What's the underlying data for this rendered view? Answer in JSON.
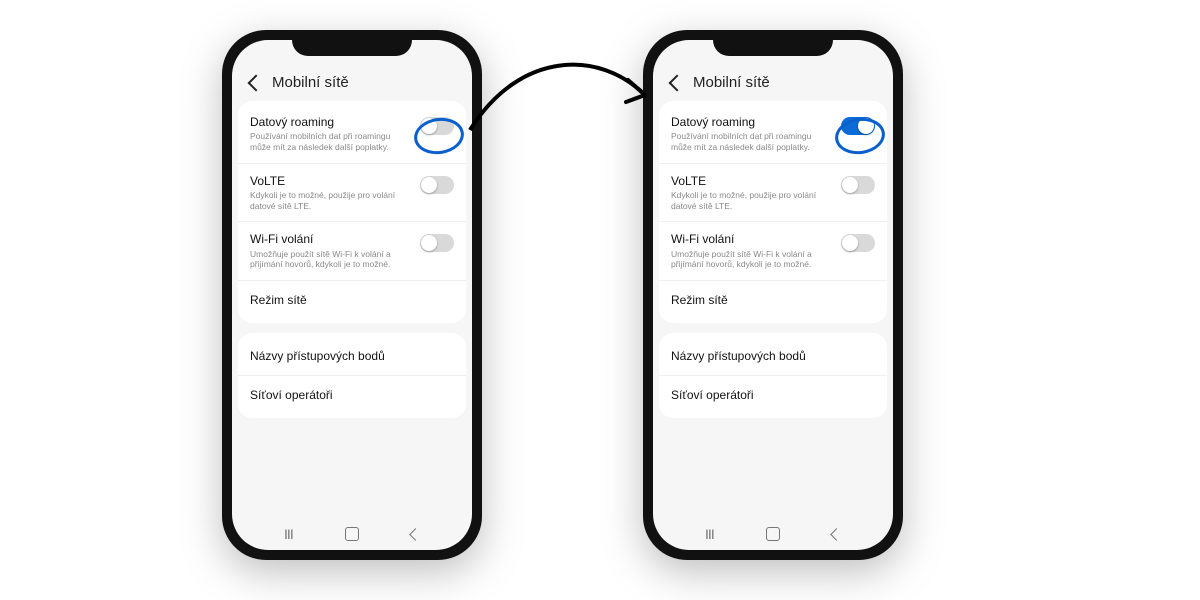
{
  "header": {
    "title": "Mobilní sítě"
  },
  "items": {
    "roaming": {
      "title": "Datový roaming",
      "desc": "Používání mobilních dat při roamingu může mít za následek další poplatky."
    },
    "volte": {
      "title": "VoLTE",
      "desc": "Kdykoli je to možné, použije pro volání datové sítě LTE."
    },
    "wifi": {
      "title": "Wi-Fi volání",
      "desc": "Umožňuje použít sítě Wi-Fi k volání a přijímání hovorů, kdykoli je to možné."
    },
    "mode": {
      "title": "Režim sítě"
    },
    "apn": {
      "title": "Názvy přístupových bodů"
    },
    "ops": {
      "title": "Síťoví operátoři"
    }
  },
  "state": {
    "left": {
      "roaming": false,
      "volte": false,
      "wifi": false
    },
    "right": {
      "roaming": true,
      "volte": false,
      "wifi": false
    }
  },
  "colors": {
    "accent": "#0a6bd6",
    "ring": "#0a5fcf"
  }
}
